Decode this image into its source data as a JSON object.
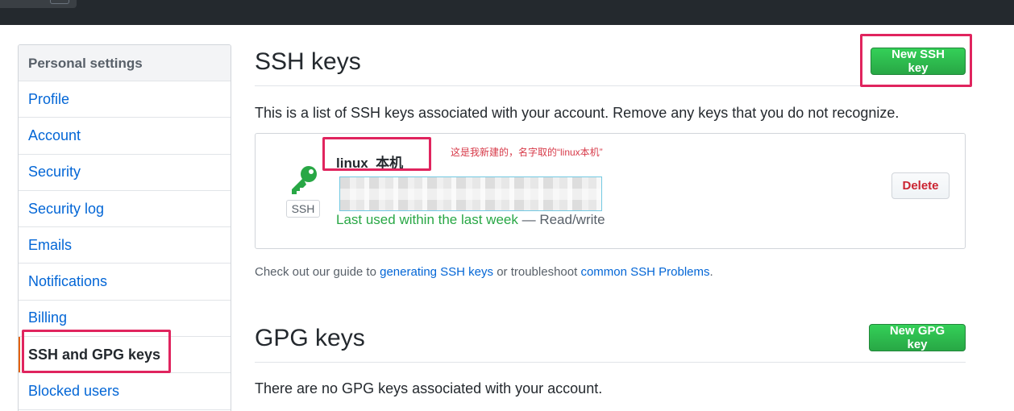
{
  "sidebar": {
    "header": "Personal settings",
    "items": [
      {
        "label": "Profile"
      },
      {
        "label": "Account"
      },
      {
        "label": "Security"
      },
      {
        "label": "Security log"
      },
      {
        "label": "Emails"
      },
      {
        "label": "Notifications"
      },
      {
        "label": "Billing"
      },
      {
        "label": "SSH and GPG keys",
        "selected": true
      },
      {
        "label": "Blocked users"
      }
    ]
  },
  "ssh": {
    "title": "SSH keys",
    "new_button": "New SSH key",
    "description": "This is a list of SSH keys associated with your account. Remove any keys that you do not recognize.",
    "key": {
      "icon": "key-icon",
      "type_badge": "SSH",
      "title": "linux_本机",
      "annotation": "这是我新建的，名字取的“linux本机”",
      "last_used": "Last used within the last week",
      "access": "— Read/write",
      "delete_label": "Delete"
    },
    "guide": {
      "prefix": "Check out our guide to",
      "link1": "generating SSH keys",
      "middle": "or troubleshoot",
      "link2": "common SSH Problems",
      "suffix": "."
    }
  },
  "gpg": {
    "title": "GPG keys",
    "new_button": "New GPG key",
    "empty_text": "There are no GPG keys associated with your account."
  },
  "colors": {
    "accent_green": "#28a745",
    "link_blue": "#0366d6",
    "danger_red": "#cb2431",
    "annotation_red": "#e0245e"
  }
}
